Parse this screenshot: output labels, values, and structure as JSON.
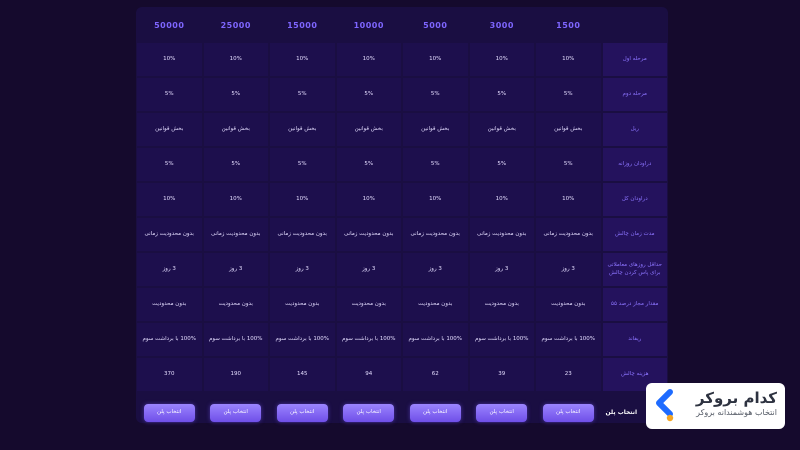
{
  "plans": {
    "headers": [
      "",
      "1500",
      "3000",
      "5000",
      "10000",
      "15000",
      "25000",
      "50000"
    ],
    "rows": [
      {
        "label": "مرحله اول",
        "values": [
          "10%",
          "10%",
          "10%",
          "10%",
          "10%",
          "10%",
          "10%"
        ]
      },
      {
        "label": "مرحله دوم",
        "values": [
          "5%",
          "5%",
          "5%",
          "5%",
          "5%",
          "5%",
          "5%"
        ]
      },
      {
        "label": "ریل",
        "values": [
          "بخش قوانین",
          "بخش قوانین",
          "بخش قوانین",
          "بخش قوانین",
          "بخش قوانین",
          "بخش قوانین",
          "بخش قوانین"
        ]
      },
      {
        "label": "دراودان روزانه",
        "values": [
          "5%",
          "5%",
          "5%",
          "5%",
          "5%",
          "5%",
          "5%"
        ]
      },
      {
        "label": "دراودان کل",
        "values": [
          "10%",
          "10%",
          "10%",
          "10%",
          "10%",
          "10%",
          "10%"
        ]
      },
      {
        "label": "مدت زمان چالش",
        "values": [
          "بدون محدودیت زمانی",
          "بدون محدودیت زمانی",
          "بدون محدودیت زمانی",
          "بدون محدودیت زمانی",
          "بدون محدودیت زمانی",
          "بدون محدودیت زمانی",
          "بدون محدودیت زمانی"
        ]
      },
      {
        "label": "حداقل روزهای معاملاتی برای پاس کردن چالش",
        "values": [
          "3 روز",
          "3 روز",
          "3 روز",
          "3 روز",
          "3 روز",
          "3 روز",
          "3 روز"
        ]
      },
      {
        "label": "مقدار مجاز درصد ۵۵",
        "values": [
          "بدون محدودیت",
          "بدون محدودیت",
          "بدون محدودیت",
          "بدون محدودیت",
          "بدون محدودیت",
          "بدون محدودیت",
          "بدون محدودیت"
        ]
      },
      {
        "label": "ریفاند",
        "values": [
          "100% با برداشت سوم",
          "100% با برداشت سوم",
          "100% با برداشت سوم",
          "100% با برداشت سوم",
          "100% با برداشت سوم",
          "100% با برداشت سوم",
          "100% با برداشت سوم"
        ]
      },
      {
        "label": "هزینه چالش",
        "values": [
          "23",
          "39",
          "62",
          "94",
          "145",
          "190",
          "370"
        ]
      }
    ],
    "footer": {
      "label": "انتخاب پلن",
      "button_label": "انتخاب پلن"
    }
  },
  "brand": {
    "name": "کدام بروکر",
    "tagline": "انتخاب هوشمندانه بروکر",
    "colors": {
      "primary": "#1e6bff",
      "accent": "#f5a623",
      "text": "#2d3240"
    },
    "logo_icon": "chevron-left-logo"
  },
  "colors": {
    "background": "#150a2d",
    "table": "#1a0e42",
    "cell": "#1d0f4d",
    "header_text": "#7e66ff",
    "button": "#7a5cf0"
  }
}
